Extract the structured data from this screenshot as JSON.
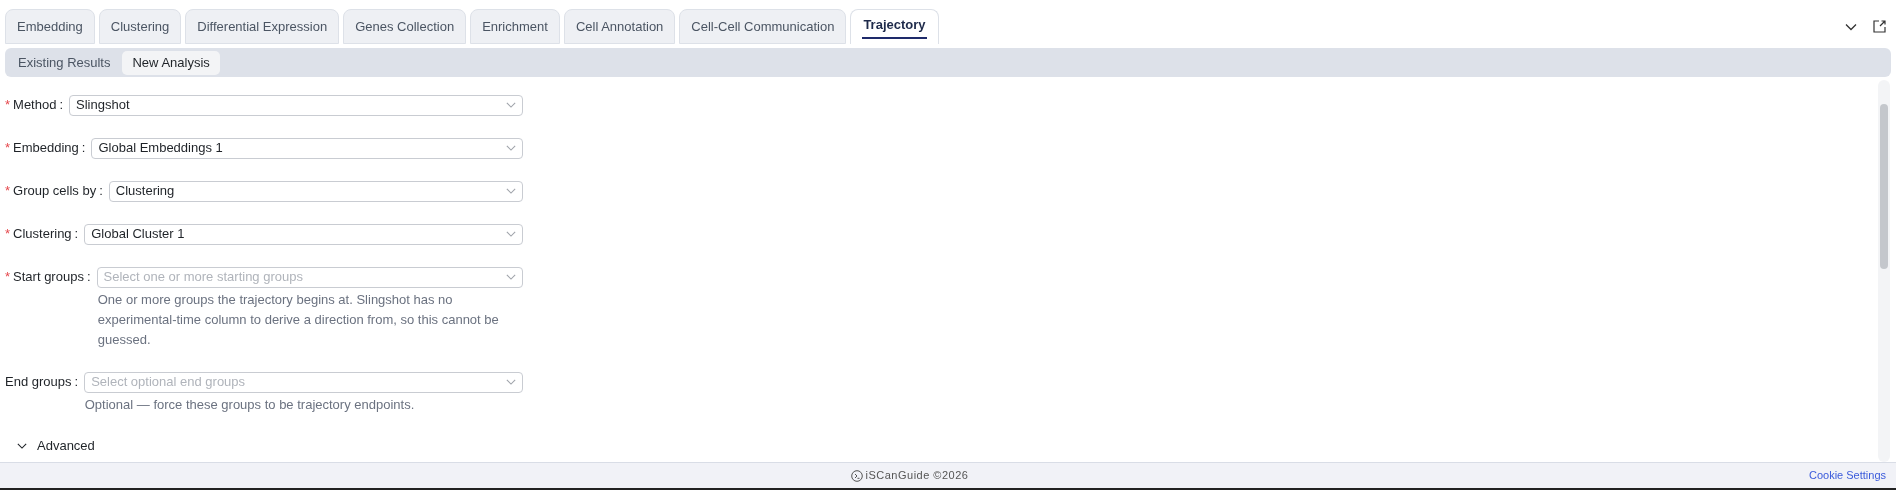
{
  "tabs": [
    {
      "label": "Embedding",
      "selected": false
    },
    {
      "label": "Clustering",
      "selected": false
    },
    {
      "label": "Differential Expression",
      "selected": false
    },
    {
      "label": "Genes Collection",
      "selected": false
    },
    {
      "label": "Enrichment",
      "selected": false
    },
    {
      "label": "Cell Annotation",
      "selected": false
    },
    {
      "label": "Cell-Cell Communication",
      "selected": false
    },
    {
      "label": "Trajectory",
      "selected": true
    }
  ],
  "subtabs": [
    {
      "label": "Existing Results",
      "selected": false
    },
    {
      "label": "New Analysis",
      "selected": true
    }
  ],
  "required_mark": "*",
  "label_colon": ":",
  "form": [
    {
      "label": "Method",
      "required": true,
      "value": "Slingshot"
    },
    {
      "label": "Embedding",
      "required": true,
      "value": "Global Embeddings 1"
    },
    {
      "label": "Group cells by",
      "required": true,
      "value": "Clustering"
    },
    {
      "label": "Clustering",
      "required": true,
      "value": "Global Cluster 1"
    },
    {
      "label": "Start groups",
      "required": true,
      "placeholder": "Select one or more starting groups",
      "help": "One or more groups the trajectory begins at. Slingshot has no experimental-time column to derive a direction from, so this cannot be guessed."
    },
    {
      "label": "End groups",
      "required": false,
      "placeholder": "Select optional end groups",
      "help": "Optional — force these groups to be trajectory endpoints."
    }
  ],
  "advanced": {
    "label": "Advanced",
    "expanded": false
  },
  "footer": {
    "brand": "iSCanGuide ©2026",
    "link": "Cookie Settings"
  }
}
